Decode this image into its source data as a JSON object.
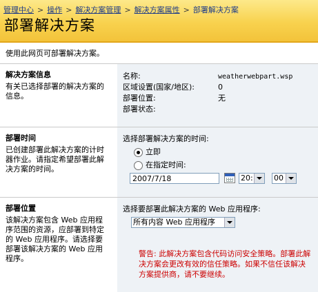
{
  "breadcrumb": {
    "items": [
      "管理中心",
      "操作",
      "解决方案管理",
      "解决方案属性"
    ],
    "current": "部署解决方案",
    "separator": ">"
  },
  "page_title": "部署解决方案",
  "intro": "使用此网页可部署解决方案。",
  "solution_info": {
    "title": "解决方案信息",
    "description": "有关已选择部署的解决方案的信息。",
    "rows": [
      {
        "label": "名称:",
        "value": "weatherwebpart.wsp"
      },
      {
        "label": "区域设置(国家/地区):",
        "value": "0"
      },
      {
        "label": "部署位置:",
        "value": "无"
      },
      {
        "label": "部署状态:",
        "value": ""
      }
    ]
  },
  "deploy_time": {
    "title": "部署时间",
    "description": "已创建部署此解决方案的计时器作业。请指定希望部署此解决方案的时间。",
    "prompt": "选择部署解决方案的时间:",
    "option_now": "立即",
    "option_specified": "在指定时间:",
    "selected_option": "立即",
    "date_value": "2007/7/18",
    "hour_value": "20:",
    "minute_value": "00"
  },
  "deploy_location": {
    "title": "部署位置",
    "description": "该解决方案包含 Web 应用程序范围的资源，应部署到特定的 Web 应用程序。请选择要部署该解决方案的 Web 应用程序。",
    "prompt": "选择要部署此解决方案的 Web 应用程序:",
    "select_value": "所有内容 Web 应用程序",
    "warning": "警告: 此解决方案包含代码访问安全策略。部署此解决方案会更改有效的信任策略。如果不信任该解决方案提供商，请不要继续。"
  },
  "colors": {
    "header_bg": "#f8d24e",
    "link": "#1f3c88",
    "panel_bg": "#eef2f6",
    "warning": "#cc0000"
  },
  "icons": [
    "calendar-icon",
    "chevron-down-icon",
    "radio-button"
  ]
}
